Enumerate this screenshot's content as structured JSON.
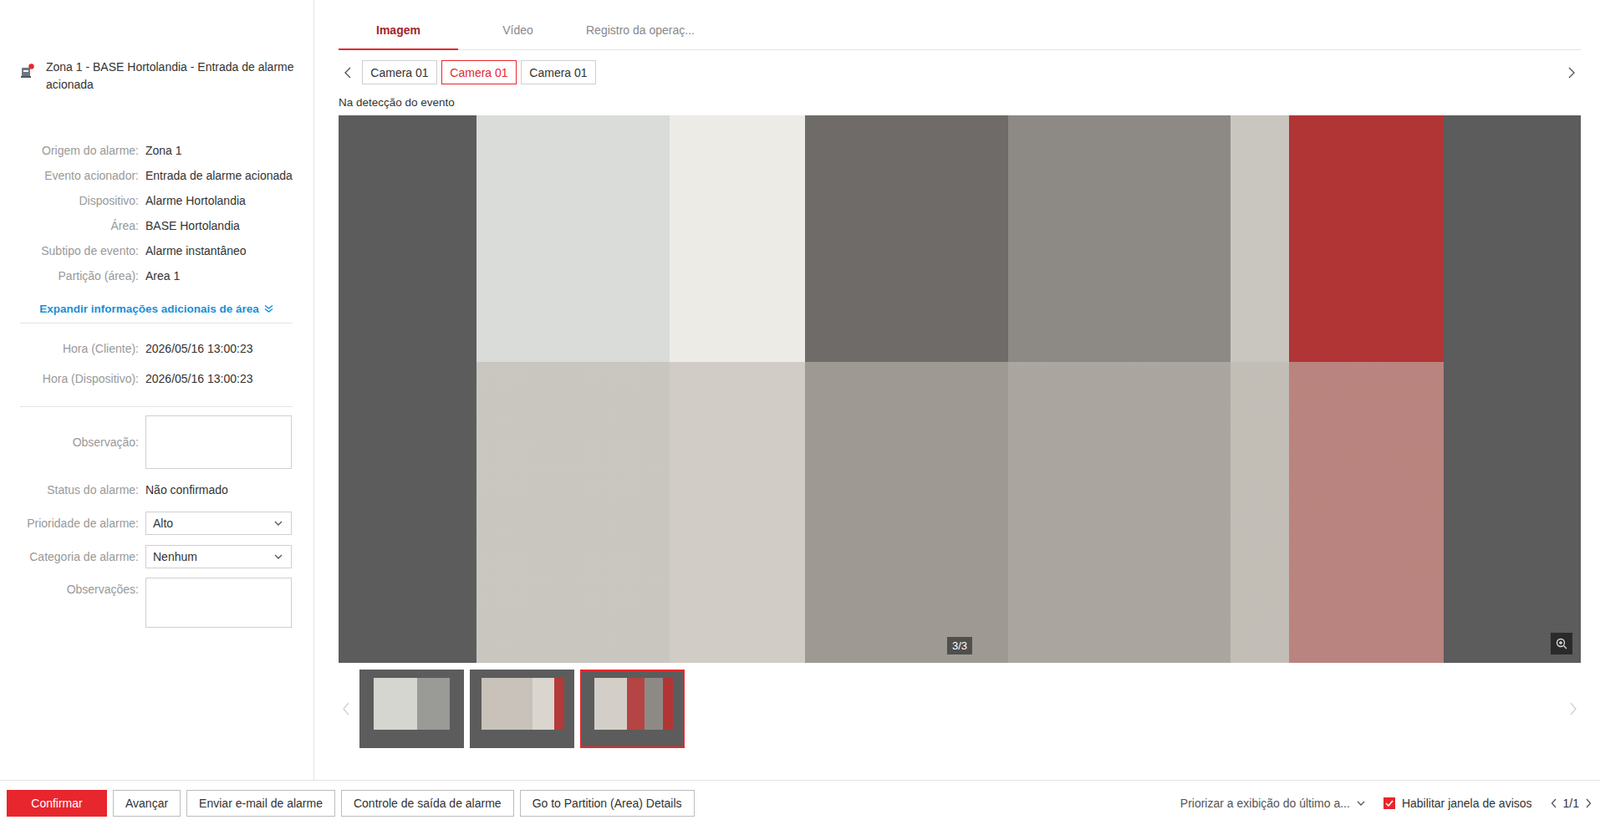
{
  "alarm": {
    "title": "Zona 1 - BASE Hortolandia - Entrada de alarme acionada",
    "fields": [
      {
        "label": "Origem do alarme:",
        "value": "Zona 1"
      },
      {
        "label": "Evento acionador:",
        "value": "Entrada de alarme acionada"
      },
      {
        "label": "Dispositivo:",
        "value": "Alarme Hortolandia"
      },
      {
        "label": "Área:",
        "value": "BASE Hortolandia"
      },
      {
        "label": "Subtipo de evento:",
        "value": "Alarme instantâneo"
      },
      {
        "label": "Partição (área):",
        "value": "Area 1"
      }
    ],
    "expand_link": "Expandir informações adicionais de área",
    "times": [
      {
        "label": "Hora (Cliente):",
        "value": "2026/05/16 13:00:23"
      },
      {
        "label": "Hora (Dispositivo):",
        "value": "2026/05/16 13:00:23"
      }
    ],
    "observation": {
      "label": "Observação:",
      "value": ""
    },
    "status": {
      "label": "Status do alarme:",
      "value": "Não confirmado"
    },
    "priority": {
      "label": "Prioridade de alarme:",
      "value": "Alto"
    },
    "category": {
      "label": "Categoria de alarme:",
      "value": "Nenhum"
    },
    "remarks": {
      "label": "Observações:",
      "value": ""
    }
  },
  "tabs": [
    {
      "label": "Imagem",
      "selected": true
    },
    {
      "label": "Vídeo",
      "selected": false
    },
    {
      "label": "Registro da operaç...",
      "selected": false
    }
  ],
  "cameras": [
    {
      "label": "Camera 01",
      "selected": false
    },
    {
      "label": "Camera 01",
      "selected": true
    },
    {
      "label": "Camera 01",
      "selected": false
    }
  ],
  "caption": "Na detecção do evento",
  "viewer": {
    "counter": "3/3"
  },
  "thumbnails": [
    {
      "selected": false
    },
    {
      "selected": false
    },
    {
      "selected": true
    }
  ],
  "actions": [
    {
      "label": "Confirmar",
      "primary": true
    },
    {
      "label": "Avançar",
      "primary": false
    },
    {
      "label": "Enviar e-mail de alarme",
      "primary": false
    },
    {
      "label": "Controle de saída de alarme",
      "primary": false
    },
    {
      "label": "Go to Partition (Area) Details",
      "primary": false
    }
  ],
  "display_priority": "Priorizar a exibição do último a...",
  "popup_toggle": {
    "label": "Habilitar janela de avisos",
    "checked": true
  },
  "pager": "1/1"
}
